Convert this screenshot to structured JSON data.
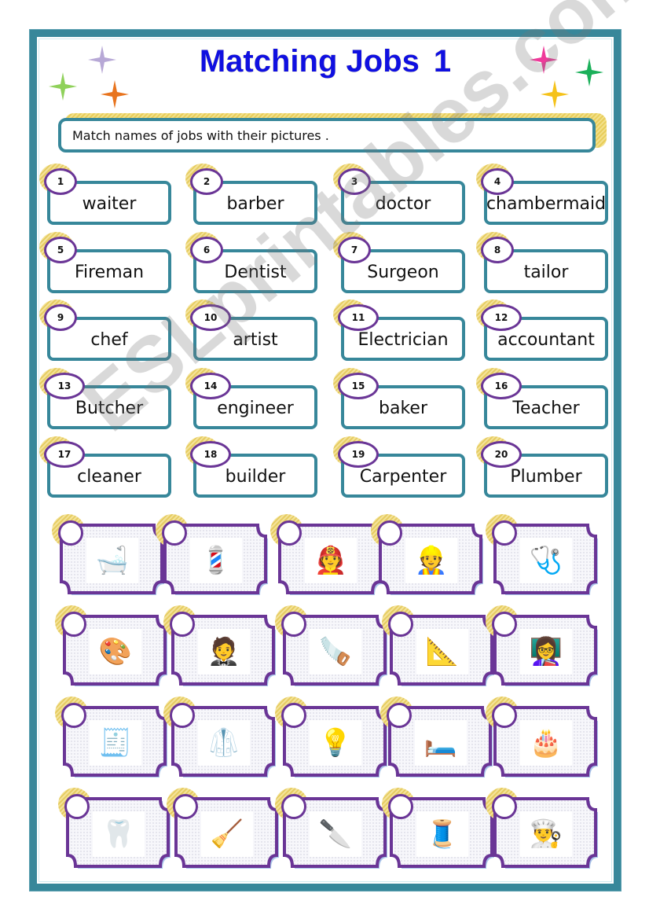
{
  "title": {
    "text": "Matching Jobs",
    "number": "1",
    "color": "#1010e0"
  },
  "instruction": "Match names of jobs with their pictures .",
  "watermark": "ESLprintables.com",
  "colors": {
    "frame": "#37879a",
    "badge_border": "#6a3596",
    "card_glow": "#e6cc62"
  },
  "sparkles": [
    {
      "color": "#b7a8d6"
    },
    {
      "color": "#8fd15a"
    },
    {
      "color": "#e8741e"
    },
    {
      "color": "#ef3a9a"
    },
    {
      "color": "#1bb05a"
    },
    {
      "color": "#f5c21a"
    }
  ],
  "words": [
    {
      "num": "1",
      "label": "waiter"
    },
    {
      "num": "2",
      "label": "barber"
    },
    {
      "num": "3",
      "label": "doctor"
    },
    {
      "num": "4",
      "label": "chambermaid"
    },
    {
      "num": "5",
      "label": "Fireman"
    },
    {
      "num": "6",
      "label": "Dentist"
    },
    {
      "num": "7",
      "label": "Surgeon"
    },
    {
      "num": "8",
      "label": "tailor"
    },
    {
      "num": "9",
      "label": "chef"
    },
    {
      "num": "10",
      "label": "artist"
    },
    {
      "num": "11",
      "label": "Electrician"
    },
    {
      "num": "12",
      "label": "accountant"
    },
    {
      "num": "13",
      "label": "Butcher"
    },
    {
      "num": "14",
      "label": "engineer"
    },
    {
      "num": "15",
      "label": "baker"
    },
    {
      "num": "16",
      "label": "Teacher"
    },
    {
      "num": "17",
      "label": "cleaner"
    },
    {
      "num": "18",
      "label": "builder"
    },
    {
      "num": "19",
      "label": "Carpenter"
    },
    {
      "num": "20",
      "label": "Plumber"
    }
  ],
  "pictures": [
    {
      "depicts": "plumber-bathtub",
      "glyph": "🛁"
    },
    {
      "depicts": "barber-client",
      "glyph": "💈"
    },
    {
      "depicts": "fireman-hose",
      "glyph": "🧑‍🚒"
    },
    {
      "depicts": "builder-carrying-plank",
      "glyph": "👷"
    },
    {
      "depicts": "doctor-patient",
      "glyph": "🩺"
    },
    {
      "depicts": "artist-palette",
      "glyph": "🎨"
    },
    {
      "depicts": "waiter-tray",
      "glyph": "🤵"
    },
    {
      "depicts": "carpenter-bench",
      "glyph": "🪚"
    },
    {
      "depicts": "engineer-blueprint",
      "glyph": "📐"
    },
    {
      "depicts": "teacher-blackboard",
      "glyph": "👩‍🏫"
    },
    {
      "depicts": "accountant-desk",
      "glyph": "🧾"
    },
    {
      "depicts": "surgeon-talking",
      "glyph": "🥼"
    },
    {
      "depicts": "electrician-phone",
      "glyph": "💡"
    },
    {
      "depicts": "chambermaid-room",
      "glyph": "🛏️"
    },
    {
      "depicts": "baker-cakes",
      "glyph": "🎂"
    },
    {
      "depicts": "dentist-xray",
      "glyph": "🦷"
    },
    {
      "depicts": "cleaner-broom",
      "glyph": "🧹"
    },
    {
      "depicts": "butcher-apron",
      "glyph": "🔪"
    },
    {
      "depicts": "tailor-sewing-machine",
      "glyph": "🧵"
    },
    {
      "depicts": "chef-rolling-pin",
      "glyph": "👨‍🍳"
    }
  ]
}
